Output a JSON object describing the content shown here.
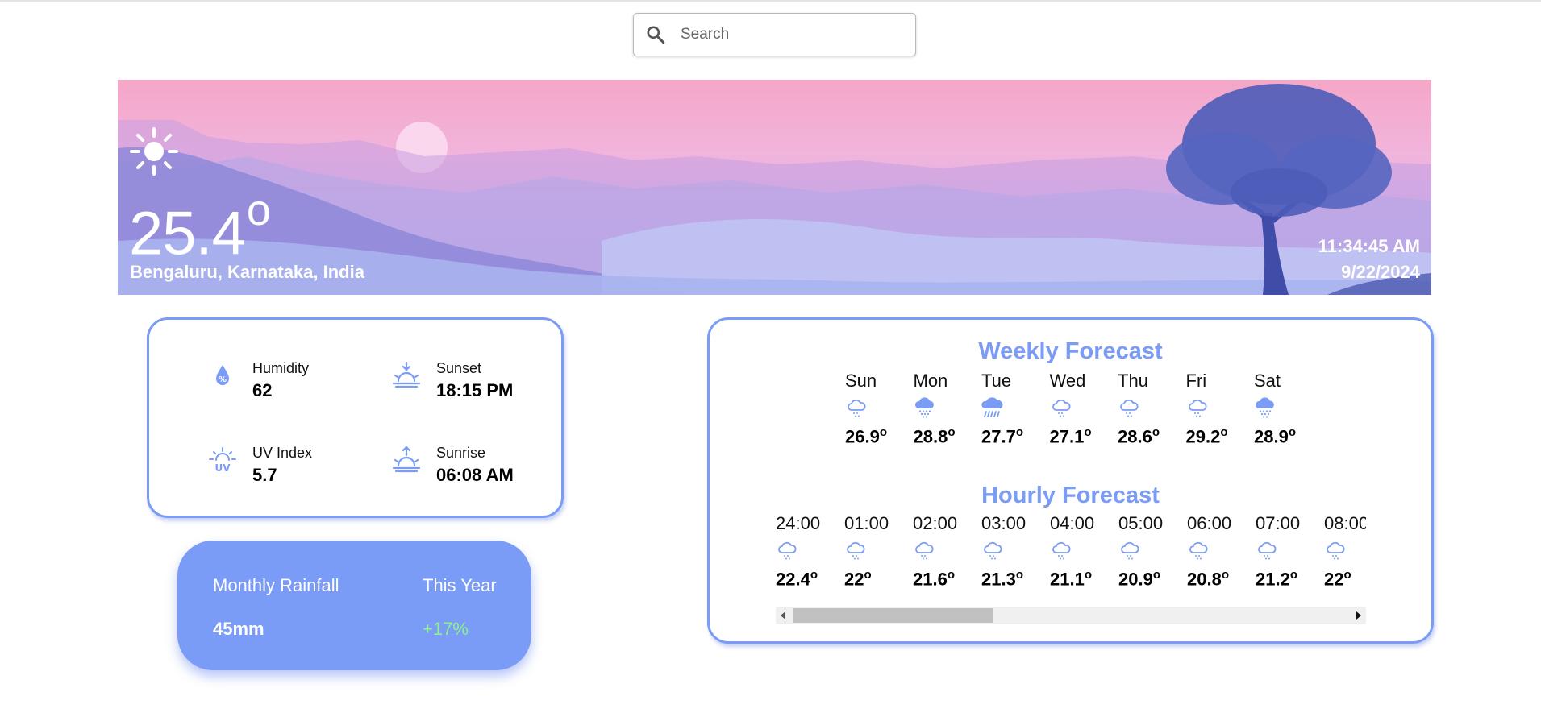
{
  "search": {
    "placeholder": "Search"
  },
  "current": {
    "temperature": "25.4",
    "degree": "o",
    "location": "Bengaluru, Karnataka, India",
    "time": "11:34:45 AM",
    "date": "9/22/2024",
    "icon": "sun-icon"
  },
  "highlights": {
    "humidity": {
      "label": "Humidity",
      "value": "62",
      "icon": "humidity-icon"
    },
    "sunset": {
      "label": "Sunset",
      "value": "18:15 PM",
      "icon": "sunset-icon"
    },
    "uv": {
      "label": "UV Index",
      "value": "5.7",
      "icon": "uv-icon"
    },
    "sunrise": {
      "label": "Sunrise",
      "value": "06:08 AM",
      "icon": "sunrise-icon"
    }
  },
  "rainfall": {
    "title": "Monthly Rainfall",
    "value": "45mm",
    "period_label": "This Year",
    "change": "+17%"
  },
  "weekly": {
    "title": "Weekly Forecast",
    "days": [
      {
        "day": "Sun",
        "temp": "26.9",
        "icon": "drizzle-icon"
      },
      {
        "day": "Mon",
        "temp": "28.8",
        "icon": "rain-cloud-icon"
      },
      {
        "day": "Tue",
        "temp": "27.7",
        "icon": "heavy-rain-icon"
      },
      {
        "day": "Wed",
        "temp": "27.1",
        "icon": "drizzle-icon"
      },
      {
        "day": "Thu",
        "temp": "28.6",
        "icon": "drizzle-icon"
      },
      {
        "day": "Fri",
        "temp": "29.2",
        "icon": "drizzle-icon"
      },
      {
        "day": "Sat",
        "temp": "28.9",
        "icon": "rain-cloud-icon"
      }
    ]
  },
  "hourly": {
    "title": "Hourly Forecast",
    "hours": [
      {
        "hour": "24:00",
        "temp": "22.4"
      },
      {
        "hour": "01:00",
        "temp": "22"
      },
      {
        "hour": "02:00",
        "temp": "21.6"
      },
      {
        "hour": "03:00",
        "temp": "21.3"
      },
      {
        "hour": "04:00",
        "temp": "21.1"
      },
      {
        "hour": "05:00",
        "temp": "20.9"
      },
      {
        "hour": "06:00",
        "temp": "20.8"
      },
      {
        "hour": "07:00",
        "temp": "21.2"
      },
      {
        "hour": "08:00",
        "temp": "22"
      }
    ]
  },
  "colors": {
    "accent": "#7b9cf5",
    "positive": "#8ef08a"
  }
}
